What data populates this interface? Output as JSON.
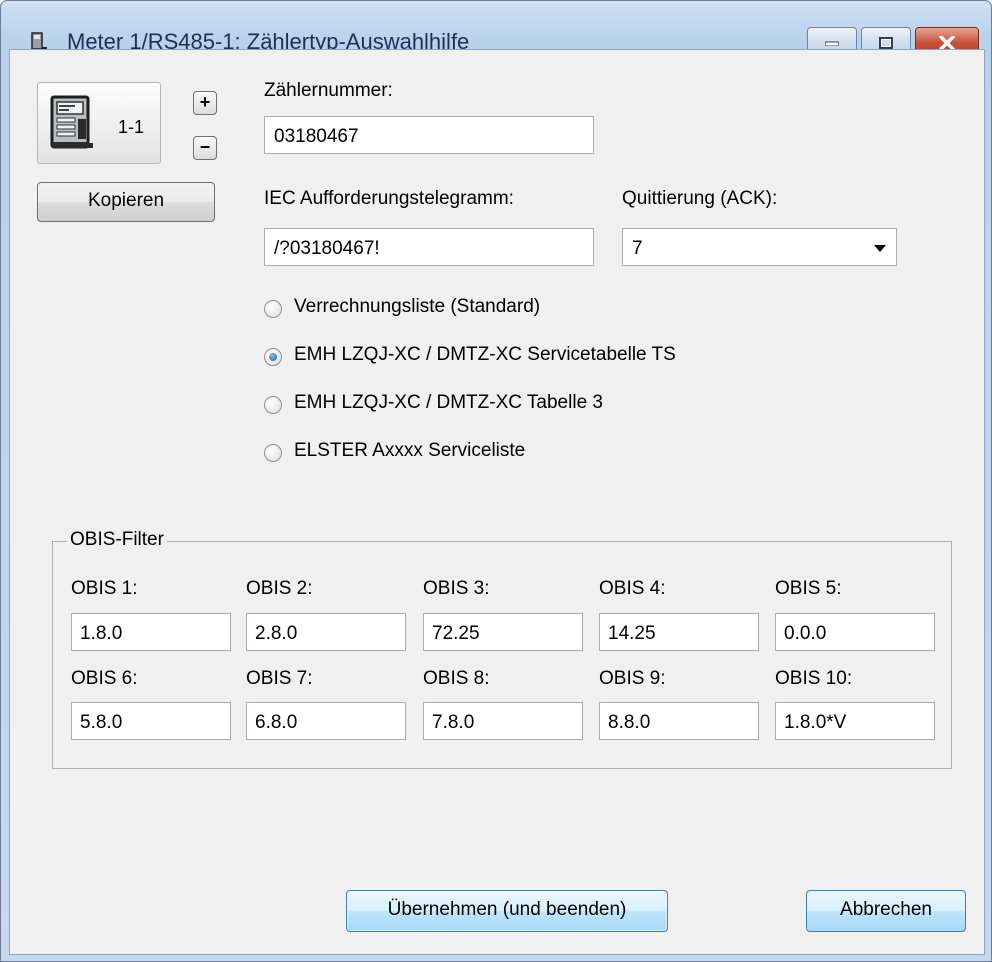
{
  "window": {
    "title": "Meter 1/RS485-1: Zählertyp-Auswahlhilfe"
  },
  "meter": {
    "id": "1-1",
    "plus_label": "+",
    "minus_label": "−"
  },
  "buttons": {
    "copy": "Kopieren",
    "apply": "Übernehmen (und beenden)",
    "cancel": "Abbrechen"
  },
  "fields": {
    "meter_number": {
      "label": "Zählernummer:",
      "value": "03180467"
    },
    "iec_request": {
      "label": "IEC Aufforderungstelegramm:",
      "value": "/?03180467!"
    },
    "ack": {
      "label": "Quittierung (ACK):",
      "value": "7"
    }
  },
  "radios": [
    {
      "label": "Verrechnungsliste (Standard)",
      "selected": false
    },
    {
      "label": "EMH LZQJ-XC / DMTZ-XC Servicetabelle TS",
      "selected": true
    },
    {
      "label": "EMH LZQJ-XC / DMTZ-XC Tabelle 3",
      "selected": false
    },
    {
      "label": "ELSTER Axxxx Serviceliste",
      "selected": false
    }
  ],
  "obis": {
    "group_title": "OBIS-Filter",
    "items": [
      {
        "label": "OBIS 1:",
        "value": "1.8.0"
      },
      {
        "label": "OBIS 2:",
        "value": "2.8.0"
      },
      {
        "label": "OBIS 3:",
        "value": "72.25"
      },
      {
        "label": "OBIS 4:",
        "value": "14.25"
      },
      {
        "label": "OBIS 5:",
        "value": "0.0.0"
      },
      {
        "label": "OBIS 6:",
        "value": "5.8.0"
      },
      {
        "label": "OBIS 7:",
        "value": "6.8.0"
      },
      {
        "label": "OBIS 8:",
        "value": "7.8.0"
      },
      {
        "label": "OBIS 9:",
        "value": "8.8.0"
      },
      {
        "label": "OBIS 10:",
        "value": "1.8.0*V"
      }
    ]
  }
}
